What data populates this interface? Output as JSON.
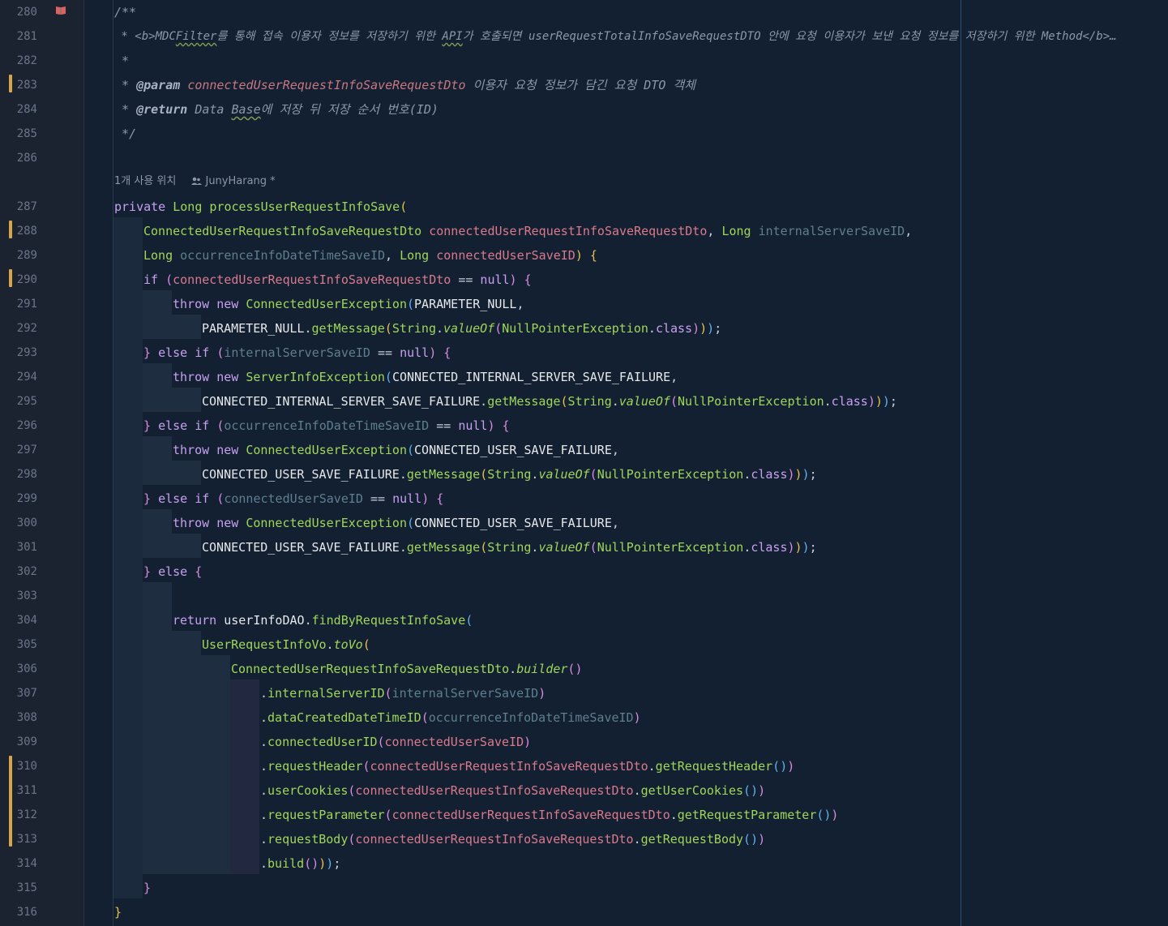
{
  "gutter": {
    "line_numbers": [
      "280",
      "281",
      "282",
      "283",
      "284",
      "285",
      "286",
      "287",
      "288",
      "289",
      "290",
      "291",
      "292",
      "293",
      "294",
      "295",
      "296",
      "297",
      "298",
      "299",
      "300",
      "301",
      "302",
      "303",
      "304",
      "305",
      "306",
      "307",
      "308",
      "309",
      "310",
      "311",
      "312",
      "313",
      "314",
      "315",
      "316"
    ]
  },
  "inlay_hint": {
    "usages": "1개 사용 위치",
    "author": "JunyHarang *"
  },
  "code": {
    "l280": "/**",
    "l281_a": " * <b>MDC",
    "l281_b": "Filter",
    "l281_c": "를 통해 접속 이용자 정보를 저장하기 위한 ",
    "l281_d": "API",
    "l281_e": "가 호출되면 userRequestTotalInfoSaveRequestDTO 안에 요청 이용자가 보낸 요청 정보를 저장하기 위한 Method</b>…",
    "l282": " *",
    "l283_a": " * ",
    "l283_tag": "@param",
    "l283_name": "connectedUserRequestInfoSaveRequestDto",
    "l283_desc": " 이용자 요청 정보가 담긴 요청 DTO 객체",
    "l284_a": " * ",
    "l284_tag": "@return",
    "l284_b": " Data ",
    "l284_c": "Base",
    "l284_d": "에 저장 뒤 저장 순서 번호(ID)",
    "l285": " */",
    "l287_kw1": "private",
    "l287_type": "Long",
    "l287_method": "processUserRequestInfoSave",
    "l287_open": "(",
    "l288_type": "ConnectedUserRequestInfoSaveRequestDto",
    "l288_param": "connectedUserRequestInfoSaveRequestDto",
    "l288_type2": "Long",
    "l288_param2": "internalServerSaveID",
    "l289_type": "Long",
    "l289_param": "occurrenceInfoDateTimeSaveID",
    "l289_type2": "Long",
    "l289_param2": "connectedUserSaveID",
    "l290_kw": "if",
    "l290_param": "connectedUserRequestInfoSaveRequestDto",
    "l290_op": " == ",
    "l290_null": "null",
    "throw": "throw",
    "new": "new",
    "l291_type": "ConnectedUserException",
    "l291_const": "PARAMETER_NULL",
    "l292_const": "PARAMETER_NULL",
    "getMessage": "getMessage",
    "String": "String",
    "valueOf": "valueOf",
    "npe": "NullPointerException",
    "class": "class",
    "else": "else",
    "if": "if",
    "null": "null",
    "l293_param": "internalServerSaveID",
    "l294_type": "ServerInfoException",
    "l294_const": "CONNECTED_INTERNAL_SERVER_SAVE_FAILURE",
    "l295_const": "CONNECTED_INTERNAL_SERVER_SAVE_FAILURE",
    "l296_param": "occurrenceInfoDateTimeSaveID",
    "l297_type": "ConnectedUserException",
    "l297_const": "CONNECTED_USER_SAVE_FAILURE",
    "l298_const": "CONNECTED_USER_SAVE_FAILURE",
    "l299_param": "connectedUserSaveID",
    "l300_type": "ConnectedUserException",
    "l300_const": "CONNECTED_USER_SAVE_FAILURE",
    "l301_const": "CONNECTED_USER_SAVE_FAILURE",
    "return": "return",
    "l304_obj": "userInfoDAO",
    "l304_method": "findByRequestInfoSave",
    "l305_type": "UserRequestInfoVo",
    "l305_method": "toVo",
    "l306_type": "ConnectedUserRequestInfoSaveRequestDto",
    "l306_method": "builder",
    "l307_method": "internalServerID",
    "l307_arg": "internalServerSaveID",
    "l308_method": "dataCreatedDateTimeID",
    "l308_arg": "occurrenceInfoDateTimeSaveID",
    "l309_method": "connectedUserID",
    "l309_arg": "connectedUserSaveID",
    "l310_method": "requestHeader",
    "l310_get": "getRequestHeader",
    "l311_method": "userCookies",
    "l311_get": "getUserCookies",
    "l312_method": "requestParameter",
    "l312_get": "getRequestParameter",
    "l313_method": "requestBody",
    "l313_get": "getRequestBody",
    "dto": "connectedUserRequestInfoSaveRequestDto",
    "l314_method": "build"
  },
  "colors": {
    "editor_bg": "#132032",
    "gutter_bg": "#1b2230",
    "change_marker": "#d8a64a",
    "keyword": "#c7a0f0",
    "type": "#9fd65a",
    "param": "#d97a8c",
    "unused_param": "#5e7f8f"
  }
}
